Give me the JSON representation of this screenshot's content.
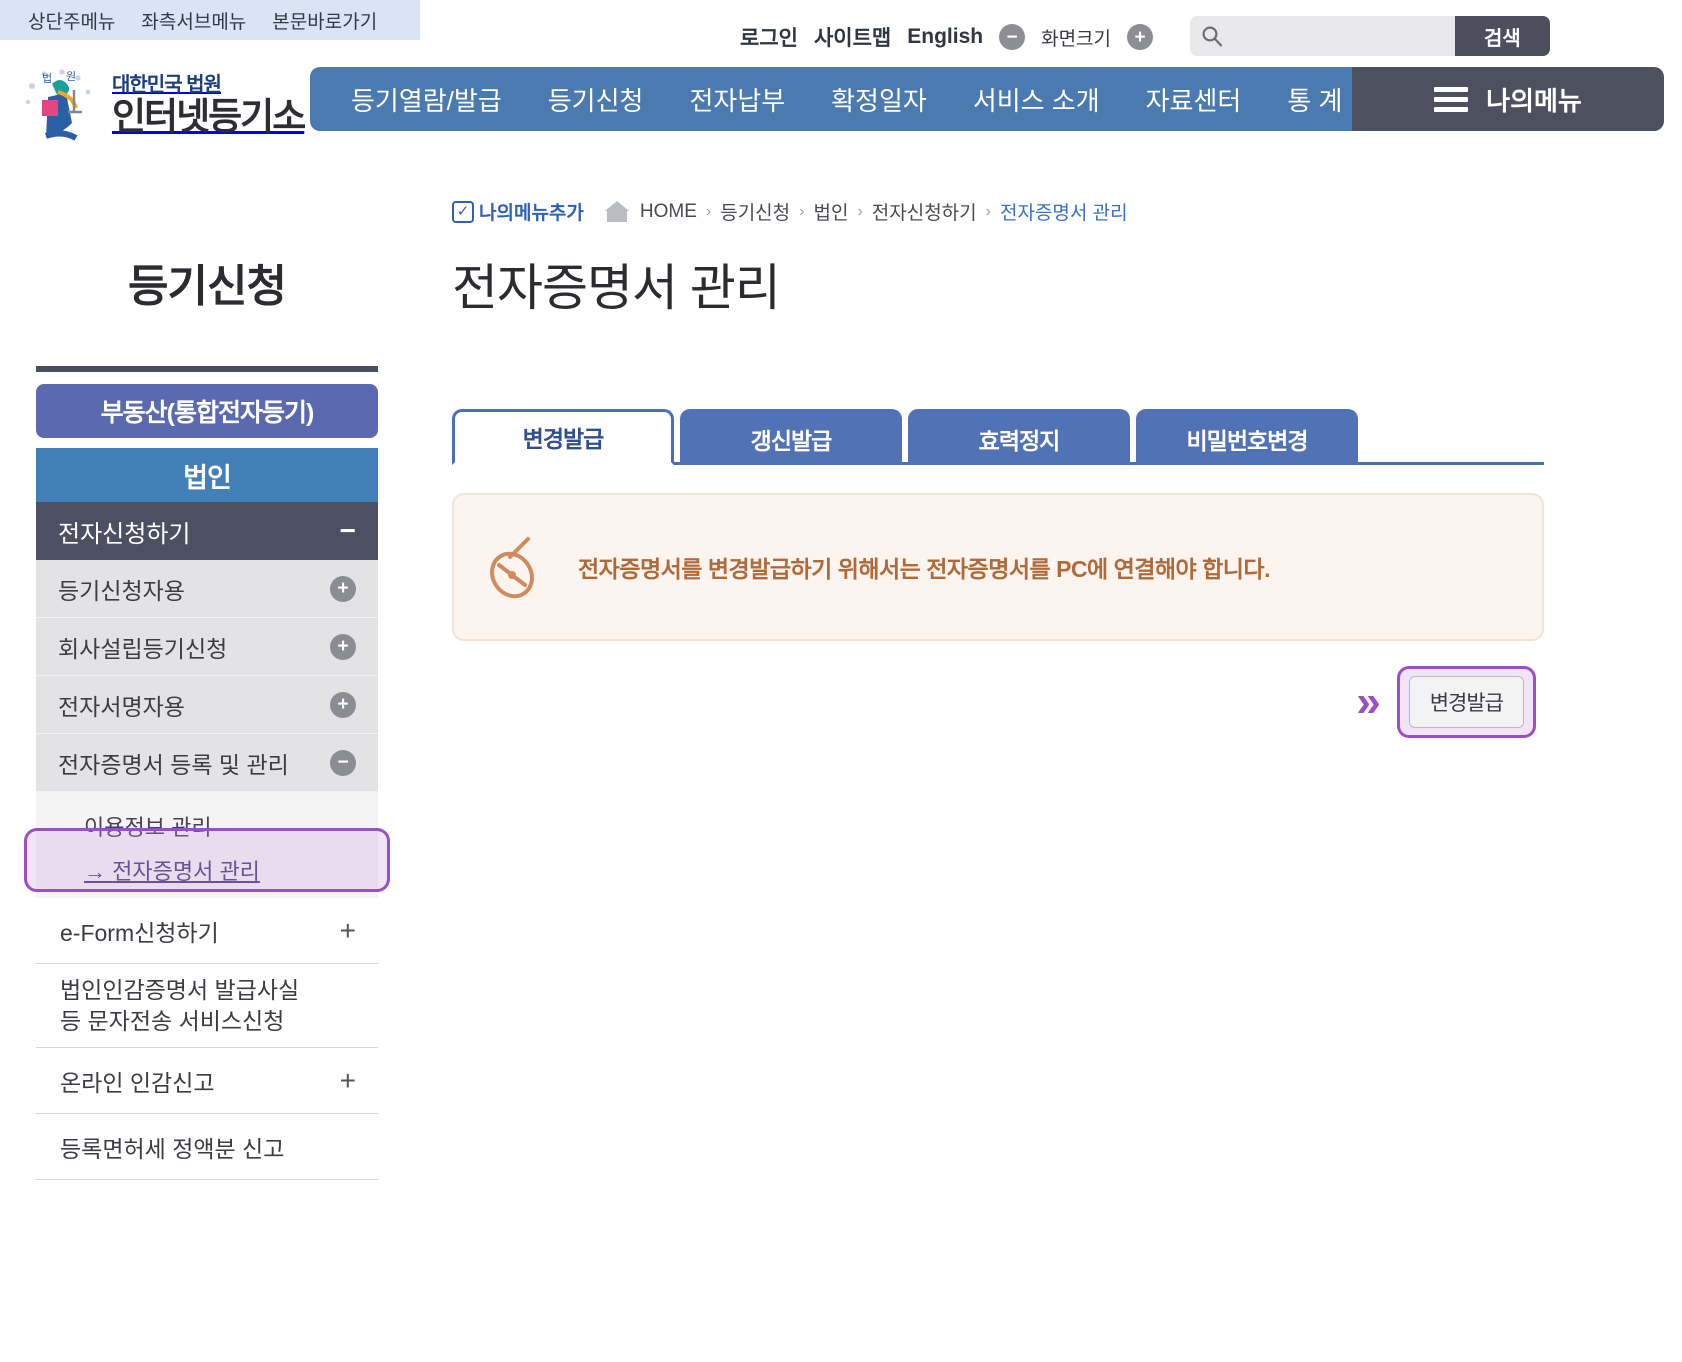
{
  "skip_nav": [
    {
      "label": "상단주메뉴"
    },
    {
      "label": "좌측서브메뉴"
    },
    {
      "label": "본문바로가기"
    }
  ],
  "utility": {
    "login": "로그인",
    "sitemap": "사이트맵",
    "english": "English",
    "zoom_out": "−",
    "screen_size_label": "화면크기",
    "zoom_in": "+"
  },
  "search": {
    "value": "",
    "placeholder": "",
    "button_label": "검색",
    "icon": "search-icon"
  },
  "logo": {
    "top_text": "대한민국 법원",
    "bottom_text": "인터넷등기소"
  },
  "gnb": {
    "items": [
      {
        "label": "등기열람/발급"
      },
      {
        "label": "등기신청"
      },
      {
        "label": "전자납부"
      },
      {
        "label": "확정일자"
      },
      {
        "label": "서비스 소개"
      },
      {
        "label": "자료센터"
      },
      {
        "label": "통 계"
      }
    ],
    "mymenu_label": "나의메뉴"
  },
  "breadcrumb": {
    "add_label": "나의메뉴추가",
    "add_icon": "checkbox-check-icon",
    "home_icon": "home-icon",
    "items": [
      {
        "label": "HOME",
        "current": false
      },
      {
        "label": "등기신청",
        "current": false
      },
      {
        "label": "법인",
        "current": false
      },
      {
        "label": "전자신청하기",
        "current": false
      },
      {
        "label": "전자증명서 관리",
        "current": true
      }
    ],
    "separator": "›"
  },
  "sidebar": {
    "section_title": "등기신청",
    "category_realestate": "부동산(통합전자등기)",
    "category_corp": "법인",
    "section_header": {
      "label": "전자신청하기",
      "sign": "−"
    },
    "items": [
      {
        "label": "등기신청자용",
        "sign": "+"
      },
      {
        "label": "회사설립등기신청",
        "sign": "+"
      },
      {
        "label": "전자서명자용",
        "sign": "+"
      },
      {
        "label": "전자증명서 등록 및 관리",
        "sign": "−"
      }
    ],
    "sub_items": [
      {
        "label": "이용정보 관리",
        "current": false
      },
      {
        "label": "전자증명서 관리",
        "current": true,
        "arrow": "→"
      }
    ],
    "plain_items": [
      {
        "label": "e-Form신청하기",
        "sign": "+",
        "two_line": false
      },
      {
        "label": "법인인감증명서 발급사실\n등 문자전송 서비스신청",
        "sign": "",
        "two_line": true,
        "line1": "법인인감증명서 발급사실",
        "line2": "등 문자전송 서비스신청"
      },
      {
        "label": "온라인 인감신고",
        "sign": "+",
        "two_line": false
      },
      {
        "label": "등록면허세 정액분 신고",
        "sign": "",
        "two_line": false
      }
    ]
  },
  "main": {
    "page_title": "전자증명서 관리",
    "tabs": [
      {
        "label": "변경발급",
        "active": true
      },
      {
        "label": "갱신발급",
        "active": false
      },
      {
        "label": "효력정지",
        "active": false
      },
      {
        "label": "비밀번호변경",
        "active": false
      }
    ],
    "notice": {
      "icon": "usb-token-mouse-icon",
      "message": "전자증명서를 변경발급하기 위해서는 전자증명서를 PC에 연결해야 합니다."
    },
    "action": {
      "chevron": "»",
      "button_label": "변경발급"
    }
  },
  "colors": {
    "nav_blue": "#4a7ab0",
    "tab_blue": "#5173b5",
    "dark_slate": "#4d505f",
    "highlight_purple": "#9b4fc4",
    "notice_bg": "#fbf4ef",
    "notice_text": "#b06a3a",
    "skipnav_bg": "#d9e4f5"
  }
}
